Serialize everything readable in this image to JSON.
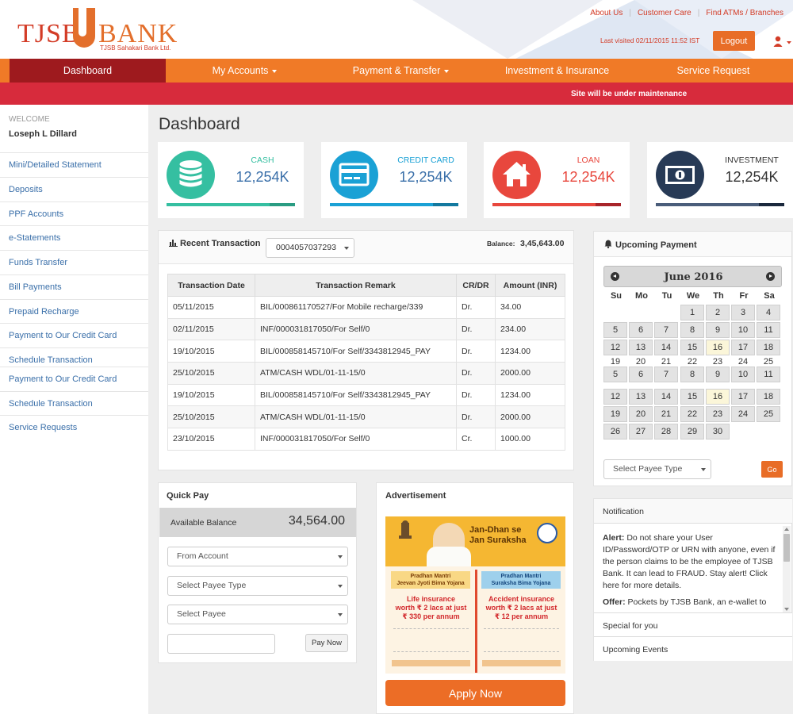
{
  "brand": {
    "name_left": "TJSB",
    "name_right": "BANK",
    "subtitle": "TJSB Sahakari Bank Ltd."
  },
  "header": {
    "links": [
      "About Us",
      "Customer Care",
      "Find ATMs / Branches"
    ],
    "last_visited": "Last visited 02/11/2015 11:52 IST",
    "logout_label": "Logout"
  },
  "nav": [
    "Dashboard",
    "My Accounts",
    "Payment & Transfer",
    "Investment & Insurance",
    "Service Request"
  ],
  "notice": "Site will be under maintenance",
  "sidebar": {
    "welcome_label": "WELCOME",
    "user_name": "Loseph L Dillard",
    "items": [
      "Mini/Detailed Statement",
      "Deposits",
      "PPF Accounts",
      "e-Statements",
      "Funds Transfer",
      "Bill Payments",
      "Prepaid Recharge",
      "Payment to Our Credit Card",
      "Schedule Transaction",
      "Payment to Our Credit Card",
      "Schedule Transaction",
      "Service Requests"
    ]
  },
  "page_title": "Dashboard",
  "cards": [
    {
      "label": "CASH",
      "value": "12,254K",
      "color": "#35bfa1",
      "dark": "#2a9c82"
    },
    {
      "label": "CREDIT CARD",
      "value": "12,254K",
      "color": "#1aa1d5",
      "dark": "#13799f"
    },
    {
      "label": "LOAN",
      "value": "12,254K",
      "color": "#e8473d",
      "dark": "#a8242a"
    },
    {
      "label": "INVESTMENT",
      "value": "12,254K",
      "color": "#273a56",
      "dark": "#1a283c"
    }
  ],
  "recent": {
    "title": "Recent Transaction",
    "account": "0004057037293",
    "balance_label": "Balance:",
    "balance": "3,45,643.00",
    "columns": [
      "Transaction Date",
      "Transaction Remark",
      "CR/DR",
      "Amount (INR)"
    ],
    "rows": [
      [
        "05/11/2015",
        "BIL/000861170527/For Mobile recharge/339",
        "Dr.",
        "34.00"
      ],
      [
        "02/11/2015",
        "INF/000031817050/For Self/0",
        "Dr.",
        "234.00"
      ],
      [
        "19/10/2015",
        "BIL/000858145710/For Self/3343812945_PAY",
        "Dr.",
        "1234.00"
      ],
      [
        "25/10/2015",
        "ATM/CASH WDL/01-11-15/0",
        "Dr.",
        "2000.00"
      ],
      [
        "19/10/2015",
        "BIL/000858145710/For Self/3343812945_PAY",
        "Dr.",
        "1234.00"
      ],
      [
        "25/10/2015",
        "ATM/CASH WDL/01-11-15/0",
        "Dr.",
        "2000.00"
      ],
      [
        "23/10/2015",
        "INF/000031817050/For Self/0",
        "Cr.",
        "1000.00"
      ]
    ]
  },
  "quickpay": {
    "title": "Quick Pay",
    "available_label": "Available Balance",
    "available_value": "34,564.00",
    "from_account": "From Account",
    "payee_type": "Select Payee Type",
    "payee": "Select Payee",
    "amount_placeholder": "",
    "pay_label": "Pay Now"
  },
  "ad": {
    "title": "Advertisement",
    "headline_1": "Jan-Dhan se",
    "headline_2": "Jan Suraksha",
    "left_scheme_1": "Pradhan Mantri",
    "left_scheme_2": "Jeevan Jyoti Bima Yojana",
    "left_offer_1": "Life insurance",
    "left_offer_2": "worth ₹ 2 lacs at just",
    "left_offer_3": "₹ 330 per annum",
    "right_scheme_1": "Pradhan Mantri",
    "right_scheme_2": "Suraksha Bima Yojana",
    "right_offer_1": "Accident insurance",
    "right_offer_2": "worth ₹ 2 lacs at just",
    "right_offer_3": "₹ 12 per annum",
    "apply_label": "Apply Now"
  },
  "upcoming": {
    "title": "Upcoming Payment",
    "month": "June 2016",
    "weekdays": [
      "Su",
      "Mo",
      "Tu",
      "We",
      "Th",
      "Fr",
      "Sa"
    ],
    "payee_select": "Select Payee Type",
    "go_label": "Go"
  },
  "notification": {
    "title": "Notification",
    "alert_label": "Alert:",
    "alert_text": " Do not share your User ID/Password/OTP or URN with anyone, even if the person claims to be the employee of TJSB Bank. It can lead to FRAUD. Stay alert! Click here for more details.",
    "offer_label": "Offer:",
    "offer_text": " Pockets by TJSB Bank, an e-wallet to",
    "rows": [
      "Special for you",
      "Upcoming Events"
    ]
  }
}
